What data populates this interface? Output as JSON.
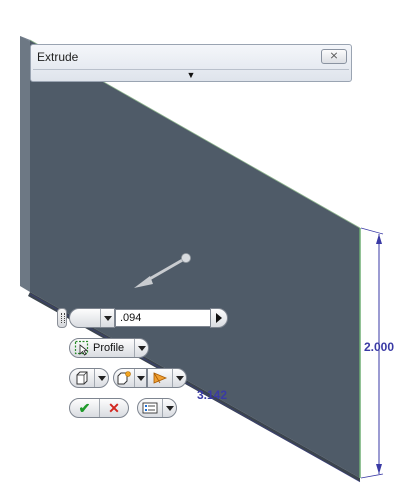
{
  "panel": {
    "title": "Extrude",
    "close_glyph": "⨯",
    "expand_glyph": "▼"
  },
  "toolbar": {
    "distance_value": ".094",
    "profile_label": "Profile",
    "ok_glyph": "✔",
    "cancel_glyph": "✕"
  },
  "dimensions": {
    "height": "2.000",
    "width": "3.142"
  },
  "colors": {
    "part_face": "#4f5b68",
    "part_edge": "#5e6a77",
    "dimension": "#3a3aa5",
    "ok": "#1f9a2a",
    "cancel": "#d2261f"
  }
}
